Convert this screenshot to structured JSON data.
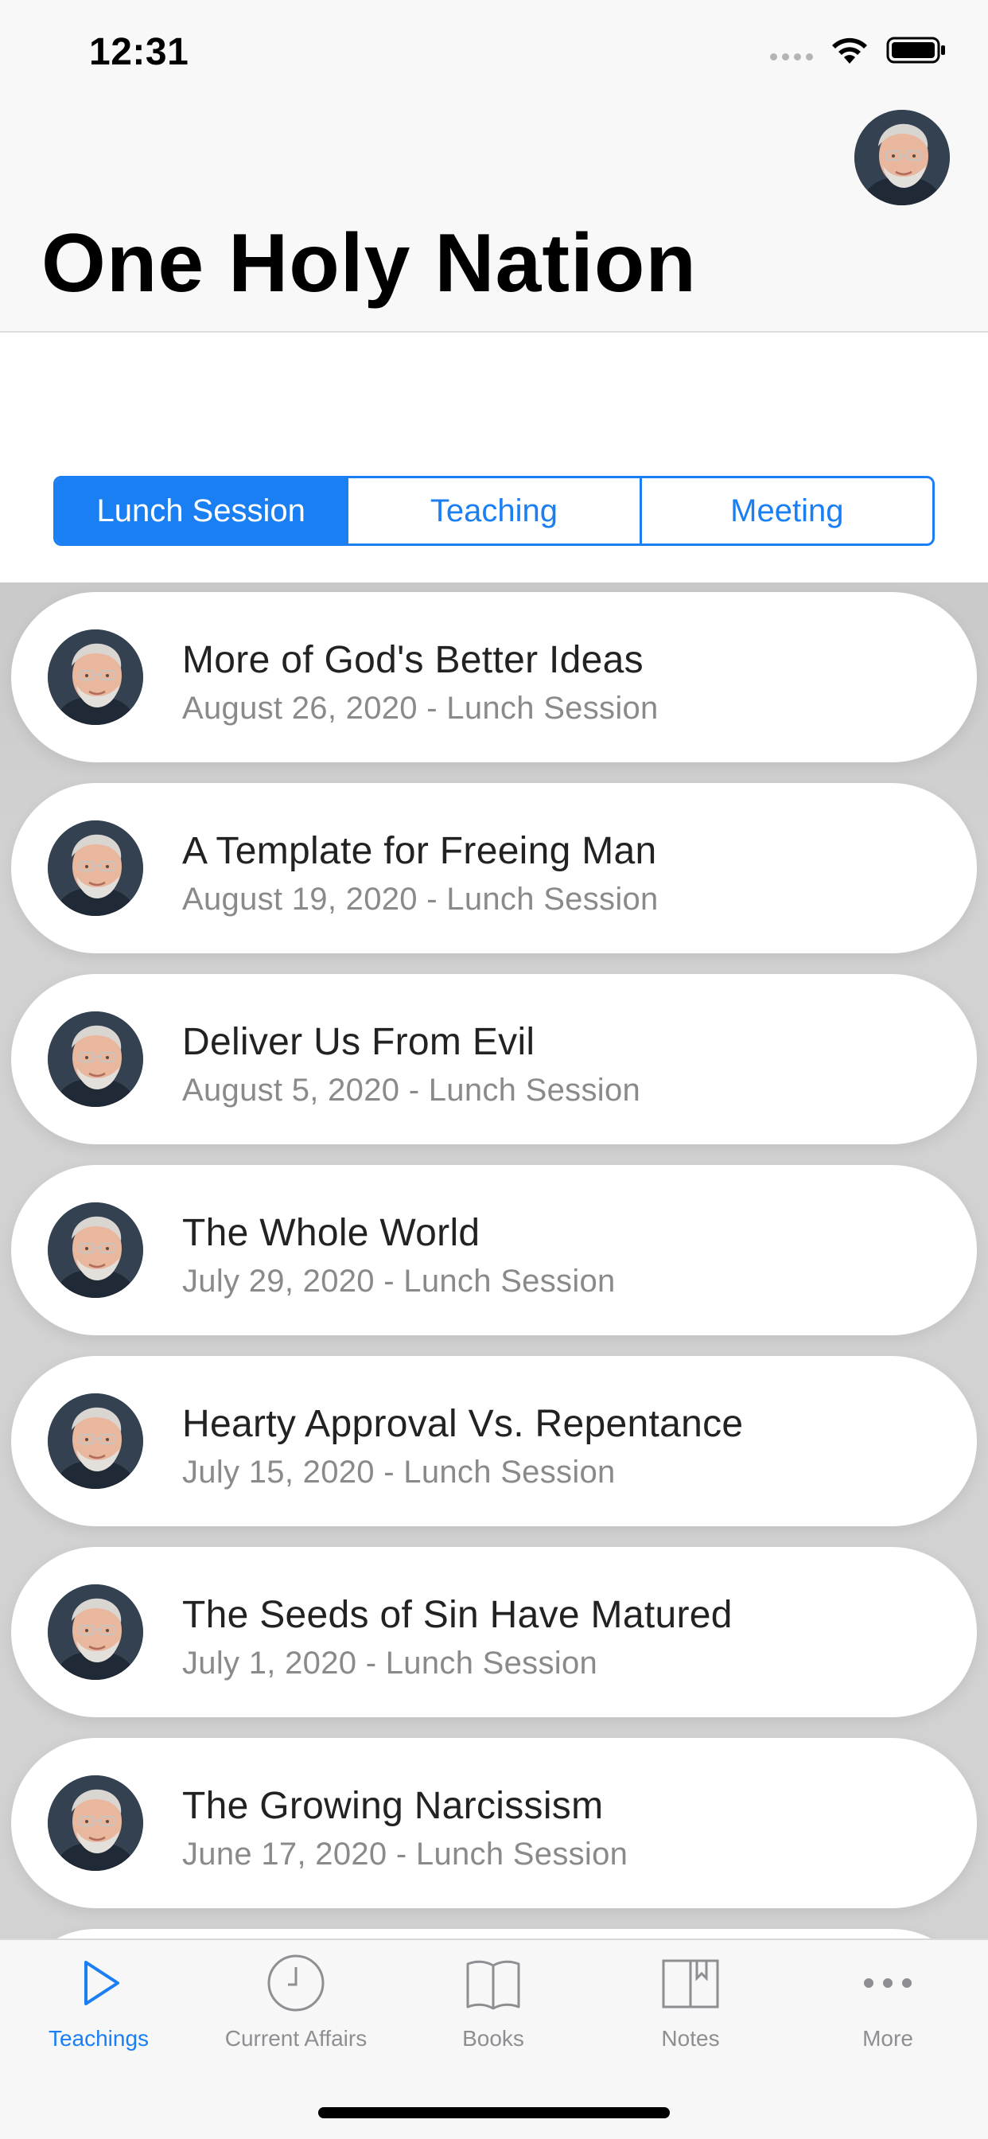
{
  "status_bar": {
    "time": "12:31"
  },
  "header": {
    "title": "One Holy Nation"
  },
  "segments": [
    {
      "label": "Lunch Session",
      "selected": true
    },
    {
      "label": "Teaching",
      "selected": false
    },
    {
      "label": "Meeting",
      "selected": false
    }
  ],
  "teachings": [
    {
      "title": "More of God's Better Ideas",
      "subtitle": "August 26, 2020 - Lunch Session"
    },
    {
      "title": "A Template for Freeing Man",
      "subtitle": "August 19, 2020 - Lunch Session"
    },
    {
      "title": "Deliver Us From Evil",
      "subtitle": "August 5, 2020 - Lunch Session"
    },
    {
      "title": "The Whole World",
      "subtitle": "July 29, 2020 - Lunch Session"
    },
    {
      "title": "Hearty Approval Vs. Repentance",
      "subtitle": "July 15, 2020 - Lunch Session"
    },
    {
      "title": "The Seeds of Sin Have Matured",
      "subtitle": "July 1, 2020 - Lunch Session"
    },
    {
      "title": "The Growing Narcissism",
      "subtitle": "June 17, 2020 - Lunch Session"
    }
  ],
  "tabbar": {
    "items": [
      {
        "label": "Teachings",
        "icon": "play-icon",
        "active": true
      },
      {
        "label": "Current Affairs",
        "icon": "clock-icon",
        "active": false
      },
      {
        "label": "Books",
        "icon": "book-icon",
        "active": false
      },
      {
        "label": "Notes",
        "icon": "bookmark-book-icon",
        "active": false
      },
      {
        "label": "More",
        "icon": "more-dots-icon",
        "active": false
      }
    ]
  },
  "colors": {
    "accent": "#1a7ff2",
    "subtitle_gray": "#8a8a8a",
    "tab_inactive": "#8e8e93"
  }
}
